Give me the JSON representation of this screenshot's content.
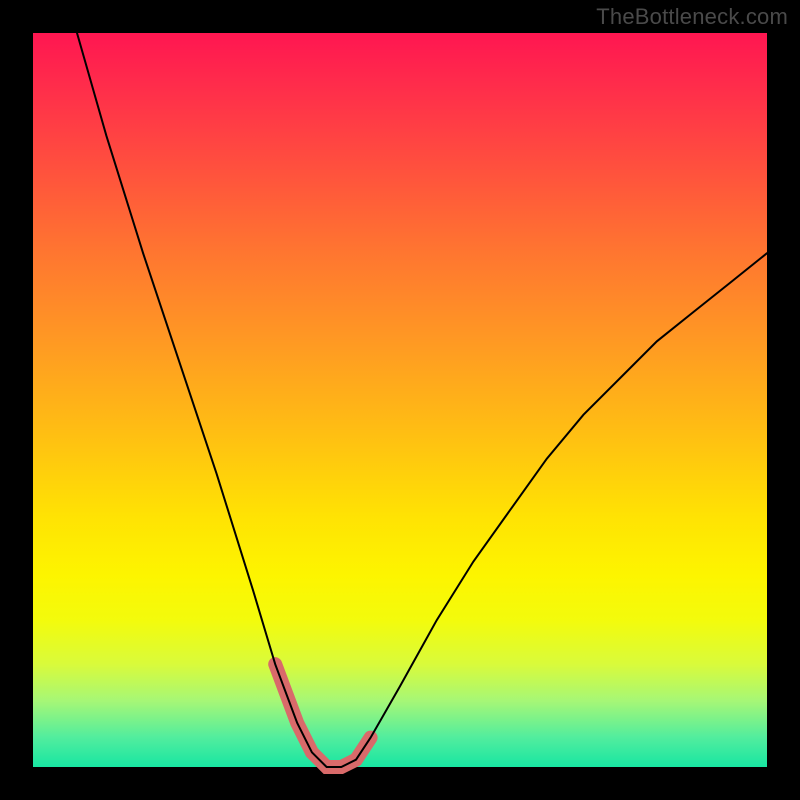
{
  "watermark": "TheBottleneck.com",
  "colors": {
    "page_bg": "#000000",
    "watermark_text": "#4a4a4a",
    "curve_stroke": "#000000",
    "highlight_stroke": "#d96a6a",
    "gradient_stops": [
      "#ff1651",
      "#ff2f4a",
      "#ff4f3e",
      "#ff7630",
      "#ff9923",
      "#ffc012",
      "#ffe303",
      "#fdf500",
      "#f3fb0c",
      "#d9fb3b",
      "#a6f776",
      "#51ed9e",
      "#18e6a2"
    ]
  },
  "chart_data": {
    "type": "line",
    "title": "",
    "xlabel": "",
    "ylabel": "",
    "xlim": [
      0,
      100
    ],
    "ylim": [
      0,
      100
    ],
    "grid": false,
    "note": "Axes are unlabeled; x and y normalized 0–100. y read as distance from bottom of gradient area (0 = bottom / green, 100 = top / red). Curve forms a sharp V-shaped valley reaching ~0 near x≈40 then rising to ~70 at x=100.",
    "series": [
      {
        "name": "bottleneck-curve",
        "x": [
          6,
          10,
          15,
          20,
          25,
          30,
          33,
          36,
          38,
          40,
          42,
          44,
          46,
          50,
          55,
          60,
          65,
          70,
          75,
          80,
          85,
          90,
          95,
          100
        ],
        "y": [
          100,
          86,
          70,
          55,
          40,
          24,
          14,
          6,
          2,
          0,
          0,
          1,
          4,
          11,
          20,
          28,
          35,
          42,
          48,
          53,
          58,
          62,
          66,
          70
        ]
      }
    ],
    "highlight_region": {
      "description": "pink thick overlay on the lowest segment of the curve (roughly x 32–47, y 0–14)",
      "x_range": [
        32,
        47
      ],
      "y_max": 14
    }
  }
}
